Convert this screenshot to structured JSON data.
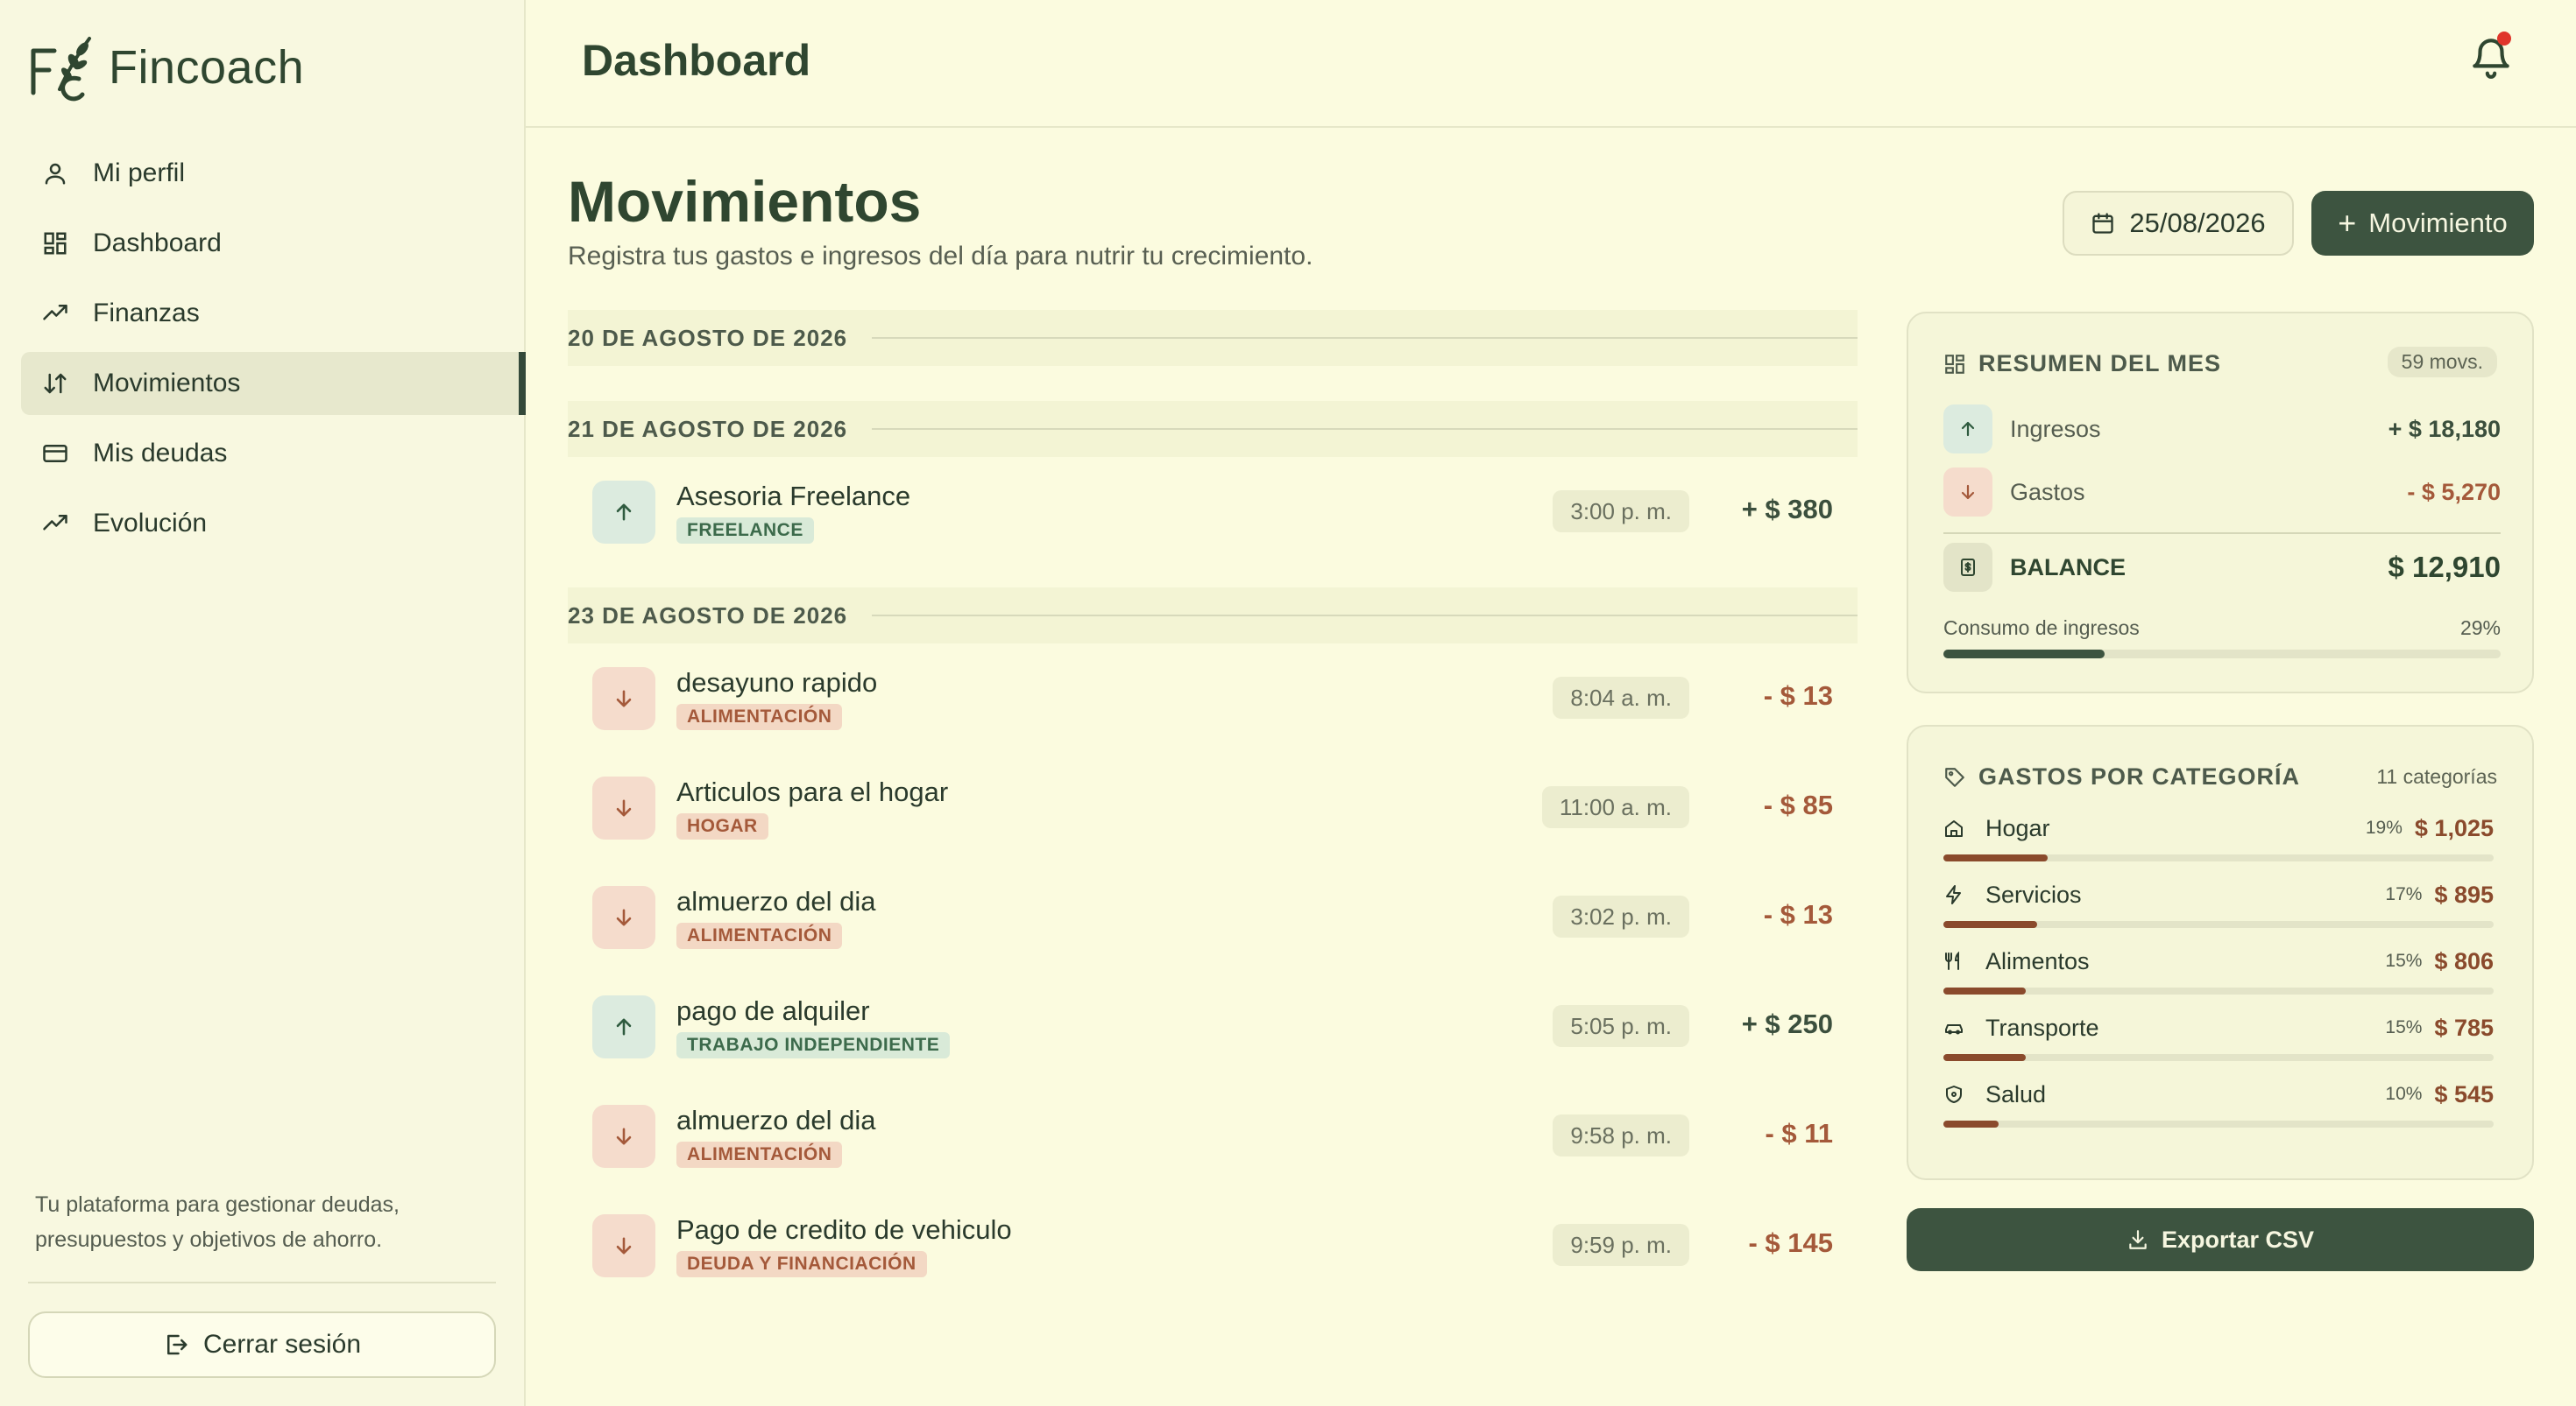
{
  "brand": {
    "name": "Fincoach"
  },
  "sidebar": {
    "items": [
      {
        "label": "Mi perfil",
        "icon": "user-icon"
      },
      {
        "label": "Dashboard",
        "icon": "grid-icon"
      },
      {
        "label": "Finanzas",
        "icon": "trending-up-icon"
      },
      {
        "label": "Movimientos",
        "icon": "arrows-up-down-icon",
        "active": true
      },
      {
        "label": "Mis deudas",
        "icon": "credit-card-icon"
      },
      {
        "label": "Evolución",
        "icon": "trending-up-icon"
      }
    ],
    "note": "Tu plataforma para gestionar deudas, presupuestos y objetivos de ahorro.",
    "logout_label": "Cerrar sesión"
  },
  "topbar": {
    "title": "Dashboard",
    "notification_dot": true
  },
  "page": {
    "title": "Movimientos",
    "subtitle": "Registra tus gastos e ingresos del día para nutrir tu crecimiento.",
    "date": "25/08/2026",
    "add_label": "Movimiento"
  },
  "days": [
    {
      "date": "20 DE AGOSTO DE 2026",
      "items": []
    },
    {
      "date": "21 DE AGOSTO DE 2026",
      "items": [
        {
          "name": "Asesoria Freelance",
          "tag": "FREELANCE",
          "time": "3:00 p. m.",
          "amount": "+ $ 380",
          "type": "in"
        }
      ]
    },
    {
      "date": "23 DE AGOSTO DE 2026",
      "items": [
        {
          "name": "desayuno rapido",
          "tag": "ALIMENTACIÓN",
          "time": "8:04 a. m.",
          "amount": "- $ 13",
          "type": "out"
        },
        {
          "name": "Articulos para el hogar",
          "tag": "HOGAR",
          "time": "11:00 a. m.",
          "amount": "- $ 85",
          "type": "out"
        },
        {
          "name": "almuerzo del dia",
          "tag": "ALIMENTACIÓN",
          "time": "3:02 p. m.",
          "amount": "- $ 13",
          "type": "out"
        },
        {
          "name": "pago de alquiler",
          "tag": "TRABAJO INDEPENDIENTE",
          "time": "5:05 p. m.",
          "amount": "+ $ 250",
          "type": "in"
        },
        {
          "name": "almuerzo del dia",
          "tag": "ALIMENTACIÓN",
          "time": "9:58 p. m.",
          "amount": "- $ 11",
          "type": "out"
        },
        {
          "name": "Pago de credito de vehiculo",
          "tag": "DEUDA Y FINANCIACIÓN",
          "time": "9:59 p. m.",
          "amount": "- $ 145",
          "type": "out"
        }
      ]
    }
  ],
  "summary": {
    "title": "RESUMEN DEL MES",
    "count": "59 movs.",
    "income_label": "Ingresos",
    "income_value": "+ $ 18,180",
    "expense_label": "Gastos",
    "expense_value": "- $ 5,270",
    "balance_label": "BALANCE",
    "balance_value": "$ 12,910",
    "consumption_label": "Consumo de ingresos",
    "consumption_pct": "29%",
    "consumption_fraction": 0.29
  },
  "categories": {
    "title": "GASTOS POR CATEGORÍA",
    "count": "11 categorías",
    "items": [
      {
        "name": "Hogar",
        "pct": "19%",
        "amount": "$ 1,025",
        "fraction": 0.19,
        "icon": "home-icon"
      },
      {
        "name": "Servicios",
        "pct": "17%",
        "amount": "$ 895",
        "fraction": 0.17,
        "icon": "bolt-icon"
      },
      {
        "name": "Alimentos",
        "pct": "15%",
        "amount": "$ 806",
        "fraction": 0.15,
        "icon": "utensils-icon"
      },
      {
        "name": "Transporte",
        "pct": "15%",
        "amount": "$ 785",
        "fraction": 0.15,
        "icon": "car-icon"
      },
      {
        "name": "Salud",
        "pct": "10%",
        "amount": "$ 545",
        "fraction": 0.1,
        "icon": "shield-icon"
      }
    ]
  },
  "export_label": "Exportar CSV",
  "colors": {
    "accent": "#3d5440",
    "income": "#3b4f3d",
    "expense": "#a4593a",
    "category_bar": "#8a4a2c",
    "consumption_bar": "#3d5440"
  }
}
